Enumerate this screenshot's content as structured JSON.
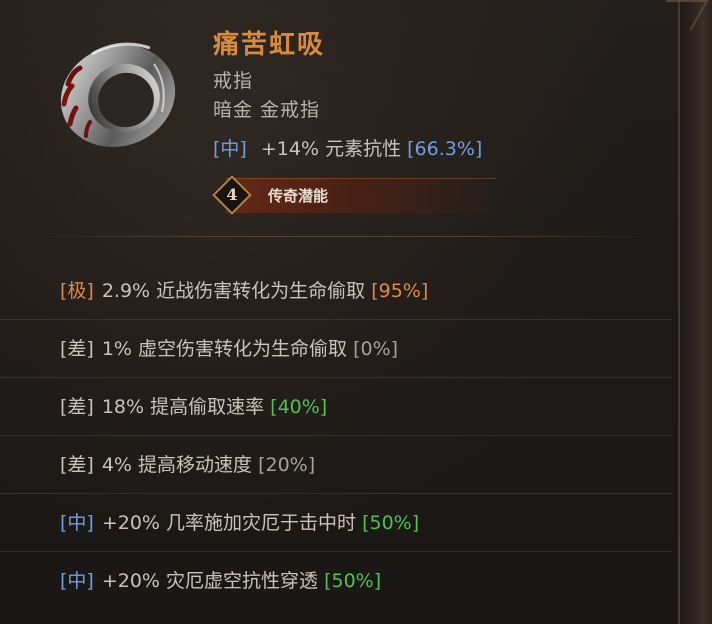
{
  "item": {
    "name": "痛苦虹吸",
    "type": "戒指",
    "rarity": "暗金 金戒指",
    "implicit": {
      "grade": "[中]",
      "text": "+14% 元素抗性",
      "percent": "[66.3%]"
    },
    "potential": {
      "level": "4",
      "label": "传奇潜能"
    },
    "affixes": [
      {
        "grade": "[极]",
        "text": "2.9% 近战伤害转化为生命偷取",
        "percent": "[95%]"
      },
      {
        "grade": "[差]",
        "text": "1% 虚空伤害转化为生命偷取",
        "percent": "[0%]"
      },
      {
        "grade": "[差]",
        "text": "18% 提高偷取速率",
        "percent": "[40%]"
      },
      {
        "grade": "[差]",
        "text": "4% 提高移动速度",
        "percent": "[20%]"
      },
      {
        "grade": "[中]",
        "text": "+20% 几率施加灾厄于击中时",
        "percent": "[50%]"
      },
      {
        "grade": "[中]",
        "text": "+20% 灾厄虚空抗性穿透",
        "percent": "[50%]"
      }
    ]
  },
  "colors": {
    "title": "#d98a3c",
    "grade_mid": "#6fa0dd",
    "grade_extreme": "#e08a45",
    "percent_green": "#4fc24f",
    "percent_grey": "#a7a19a",
    "text": "#c9c3bb"
  },
  "icons": {
    "item_icon": "metal-ring-icon",
    "potential_icon": "diamond-badge-icon"
  }
}
